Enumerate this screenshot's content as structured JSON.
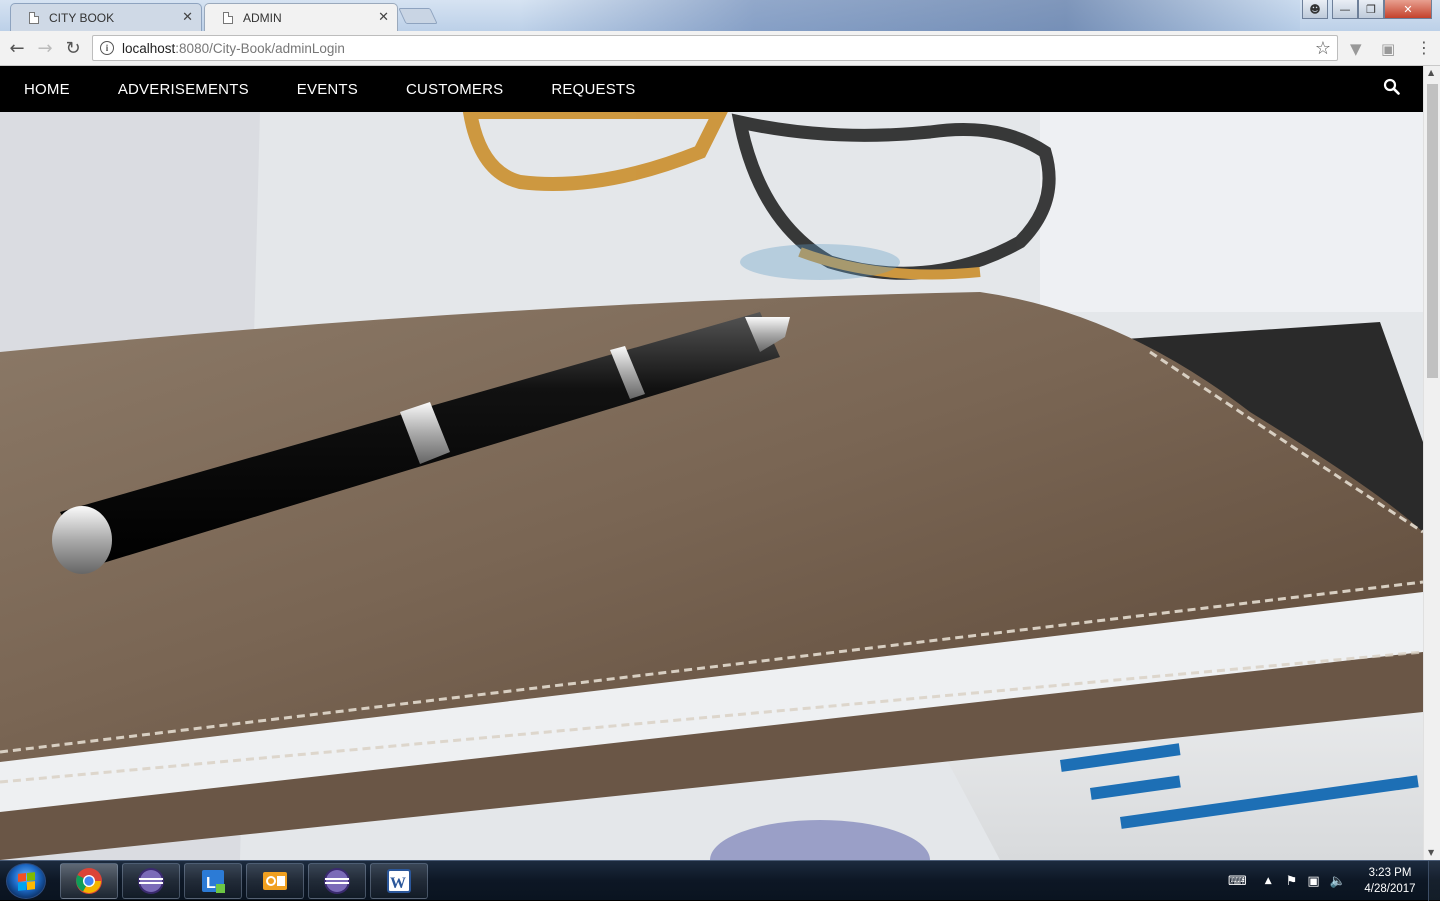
{
  "browser": {
    "tabs": [
      {
        "label": "CITY BOOK",
        "active": false
      },
      {
        "label": "ADMIN",
        "active": true
      }
    ],
    "address": {
      "host": "localhost",
      "path": ":8080/City-Book/adminLogin"
    }
  },
  "site": {
    "nav": [
      {
        "label": "HOME"
      },
      {
        "label": "ADVERISEMENTS"
      },
      {
        "label": "EVENTS"
      },
      {
        "label": "CUSTOMERS"
      },
      {
        "label": "REQUESTS"
      }
    ],
    "hero_image": "desk-notebook-pen-glasses-photo"
  },
  "taskbar": {
    "apps": [
      "chrome",
      "eclipse",
      "lync",
      "outlook",
      "eclipse",
      "word"
    ],
    "clock": {
      "time": "3:23 PM",
      "date": "4/28/2017"
    }
  },
  "colors": {
    "nav_bg": "#000000",
    "nav_text": "#ffffff"
  }
}
